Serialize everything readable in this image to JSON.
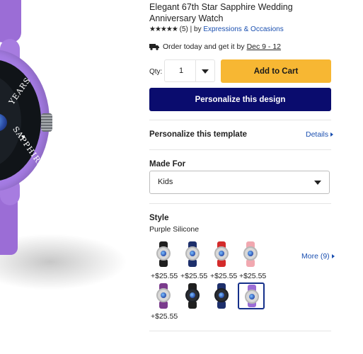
{
  "product": {
    "title": "Elegant 67th Star Sapphire Wedding Anniversary Watch",
    "stars": "★★★★★",
    "review_count": "(5)",
    "by_label": "| by",
    "seller": "Expressions & Occasions",
    "rating": 5
  },
  "delivery": {
    "text": "Order today and get it by",
    "date": "Dec 9 - 12"
  },
  "quantity": {
    "label": "Qty:",
    "value": "1"
  },
  "buttons": {
    "add_to_cart": "Add to Cart",
    "personalize": "Personalize this design"
  },
  "personalize_template": {
    "label": "Personalize this template",
    "link": "Details"
  },
  "made_for": {
    "label": "Made For",
    "selected": "Kids"
  },
  "style": {
    "label": "Style",
    "selected": "Purple Silicone",
    "more": "More (9)",
    "options": [
      {
        "band": "#1f1f1f",
        "face": "light",
        "price": "+$25.55"
      },
      {
        "band": "#1d2f6b",
        "face": "light",
        "price": "+$25.55"
      },
      {
        "band": "#d42b2b",
        "face": "light",
        "price": "+$25.55"
      },
      {
        "band": "#f1a8b0",
        "face": "light",
        "price": "+$25.55"
      },
      {
        "band": "#7a3b8c",
        "face": "light",
        "price": "+$25.55"
      },
      {
        "band": "#1f1f1f",
        "face": "dark",
        "price": ""
      },
      {
        "band": "#1d2f6b",
        "face": "dark",
        "price": ""
      },
      {
        "band": "#9b6dd6",
        "face": "light",
        "price": ""
      }
    ]
  },
  "image": {
    "rim_text_top": "YEARS",
    "rim_text_bottom": "SAPPHIRES",
    "band_color": "#9b6dd6"
  },
  "colors": {
    "link": "#1a4fb0",
    "cart_button": "#f7b733",
    "personalize_button": "#0a0c6e"
  }
}
